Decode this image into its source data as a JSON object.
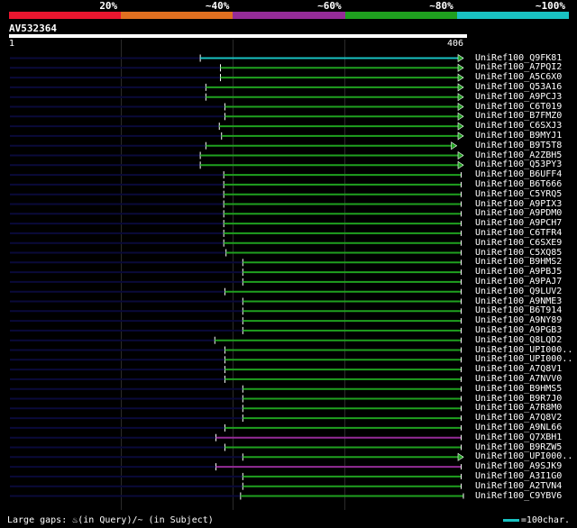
{
  "legend": {
    "segments": [
      {
        "color": "#e8162f",
        "label": "20%"
      },
      {
        "color": "#e07020",
        "label": "~40%"
      },
      {
        "color": "#952c98",
        "label": "~60%"
      },
      {
        "color": "#1fa01f",
        "label": "~80%"
      },
      {
        "color": "#19c2c2",
        "label": "~100%"
      }
    ]
  },
  "query": {
    "title": "AV532364",
    "start_label": "1",
    "end_label": "406",
    "length": 406
  },
  "colors": {
    "background": "#000000",
    "unaligned": "#0a0a3a",
    "grid": "#2b2b2b",
    "arrow_fill": "#1fa01f"
  },
  "hits": [
    {
      "name": "UniRef100_Q9FK81",
      "start": 171,
      "end": 406,
      "color": "#19c2c2",
      "arrow": "right"
    },
    {
      "name": "UniRef100_A7PQI2",
      "start": 189,
      "end": 406,
      "color": "#1fa01f",
      "arrow": "right"
    },
    {
      "name": "UniRef100_A5C6X0",
      "start": 189,
      "end": 406,
      "color": "#1fa01f",
      "arrow": "right"
    },
    {
      "name": "UniRef100_Q53A16",
      "start": 176,
      "end": 406,
      "color": "#1fa01f",
      "arrow": "right"
    },
    {
      "name": "UniRef100_A9PCJ3",
      "start": 176,
      "end": 406,
      "color": "#1fa01f",
      "arrow": "right"
    },
    {
      "name": "UniRef100_C6T019",
      "start": 193,
      "end": 406,
      "color": "#1fa01f",
      "arrow": "right"
    },
    {
      "name": "UniRef100_B7FMZ0",
      "start": 193,
      "end": 406,
      "color": "#1fa01f",
      "arrow": "right"
    },
    {
      "name": "UniRef100_C6SXJ3",
      "start": 188,
      "end": 406,
      "color": "#1fa01f",
      "arrow": "right"
    },
    {
      "name": "UniRef100_B9MYJ1",
      "start": 190,
      "end": 406,
      "color": "#1fa01f",
      "arrow": "right"
    },
    {
      "name": "UniRef100_B9T5T8",
      "start": 176,
      "end": 400,
      "color": "#1fa01f",
      "arrow": "right"
    },
    {
      "name": "UniRef100_A2ZBH5",
      "start": 171,
      "end": 406,
      "color": "#1fa01f",
      "arrow": "right"
    },
    {
      "name": "UniRef100_Q53PY3",
      "start": 171,
      "end": 406,
      "color": "#1fa01f",
      "arrow": "right"
    },
    {
      "name": "UniRef100_B6UFF4",
      "start": 192,
      "end": 404,
      "color": "#1fa01f",
      "arrow": "none"
    },
    {
      "name": "UniRef100_B6T666",
      "start": 192,
      "end": 404,
      "color": "#1fa01f",
      "arrow": "none"
    },
    {
      "name": "UniRef100_C5YRQ5",
      "start": 192,
      "end": 404,
      "color": "#1fa01f",
      "arrow": "none"
    },
    {
      "name": "UniRef100_A9PIX3",
      "start": 192,
      "end": 404,
      "color": "#1fa01f",
      "arrow": "none"
    },
    {
      "name": "UniRef100_A9PDM0",
      "start": 192,
      "end": 404,
      "color": "#1fa01f",
      "arrow": "none"
    },
    {
      "name": "UniRef100_A9PCH7",
      "start": 192,
      "end": 404,
      "color": "#1fa01f",
      "arrow": "none"
    },
    {
      "name": "UniRef100_C6TFR4",
      "start": 192,
      "end": 404,
      "color": "#1fa01f",
      "arrow": "none"
    },
    {
      "name": "UniRef100_C6SXE9",
      "start": 192,
      "end": 404,
      "color": "#1fa01f",
      "arrow": "none"
    },
    {
      "name": "UniRef100_C5XQ85",
      "start": 194,
      "end": 404,
      "color": "#1fa01f",
      "arrow": "none"
    },
    {
      "name": "UniRef100_B9HMS2",
      "start": 209,
      "end": 404,
      "color": "#1fa01f",
      "arrow": "none"
    },
    {
      "name": "UniRef100_A9PBJ5",
      "start": 209,
      "end": 404,
      "color": "#1fa01f",
      "arrow": "none"
    },
    {
      "name": "UniRef100_A9PAJ7",
      "start": 209,
      "end": 404,
      "color": "#1fa01f",
      "arrow": "none"
    },
    {
      "name": "UniRef100_Q9LUV2",
      "start": 193,
      "end": 404,
      "color": "#1fa01f",
      "arrow": "none"
    },
    {
      "name": "UniRef100_A9NME3",
      "start": 209,
      "end": 404,
      "color": "#1fa01f",
      "arrow": "none"
    },
    {
      "name": "UniRef100_B6T914",
      "start": 209,
      "end": 404,
      "color": "#1fa01f",
      "arrow": "none"
    },
    {
      "name": "UniRef100_A9NY89",
      "start": 209,
      "end": 404,
      "color": "#1fa01f",
      "arrow": "none"
    },
    {
      "name": "UniRef100_A9PGB3",
      "start": 209,
      "end": 404,
      "color": "#1fa01f",
      "arrow": "none"
    },
    {
      "name": "UniRef100_Q8LQD2",
      "start": 184,
      "end": 404,
      "color": "#1fa01f",
      "arrow": "none"
    },
    {
      "name": "UniRef100_UPI000..",
      "start": 193,
      "end": 404,
      "color": "#1fa01f",
      "arrow": "none"
    },
    {
      "name": "UniRef100_UPI000..",
      "start": 193,
      "end": 404,
      "color": "#1fa01f",
      "arrow": "none"
    },
    {
      "name": "UniRef100_A7Q8V1",
      "start": 193,
      "end": 404,
      "color": "#1fa01f",
      "arrow": "none"
    },
    {
      "name": "UniRef100_A7NVV0",
      "start": 193,
      "end": 404,
      "color": "#1fa01f",
      "arrow": "none"
    },
    {
      "name": "UniRef100_B9HMS5",
      "start": 209,
      "end": 404,
      "color": "#1fa01f",
      "arrow": "none"
    },
    {
      "name": "UniRef100_B9R7J0",
      "start": 209,
      "end": 404,
      "color": "#1fa01f",
      "arrow": "none"
    },
    {
      "name": "UniRef100_A7R8M0",
      "start": 209,
      "end": 404,
      "color": "#1fa01f",
      "arrow": "none"
    },
    {
      "name": "UniRef100_A7Q8V2",
      "start": 209,
      "end": 404,
      "color": "#1fa01f",
      "arrow": "none"
    },
    {
      "name": "UniRef100_A9NL66",
      "start": 193,
      "end": 404,
      "color": "#1fa01f",
      "arrow": "none"
    },
    {
      "name": "UniRef100_Q7XBH1",
      "start": 185,
      "end": 404,
      "color": "#952c98",
      "arrow": "none"
    },
    {
      "name": "UniRef100_B9RZW5",
      "start": 193,
      "end": 404,
      "color": "#1fa01f",
      "arrow": "none"
    },
    {
      "name": "UniRef100_UPI000..",
      "start": 209,
      "end": 406,
      "color": "#1fa01f",
      "arrow": "right"
    },
    {
      "name": "UniRef100_A9SJK9",
      "start": 185,
      "end": 404,
      "color": "#952c98",
      "arrow": "none"
    },
    {
      "name": "UniRef100_A3I1G0",
      "start": 209,
      "end": 404,
      "color": "#1fa01f",
      "arrow": "none"
    },
    {
      "name": "UniRef100_A2TVN4",
      "start": 209,
      "end": 404,
      "color": "#1fa01f",
      "arrow": "none"
    },
    {
      "name": "UniRef100_C9YBV6",
      "start": 207,
      "end": 406,
      "color": "#1fa01f",
      "arrow": "none"
    }
  ],
  "footer": {
    "gaps_text": "Large gaps: ♨(in Query)/~ (in Subject)",
    "scale_text": "=100char."
  }
}
